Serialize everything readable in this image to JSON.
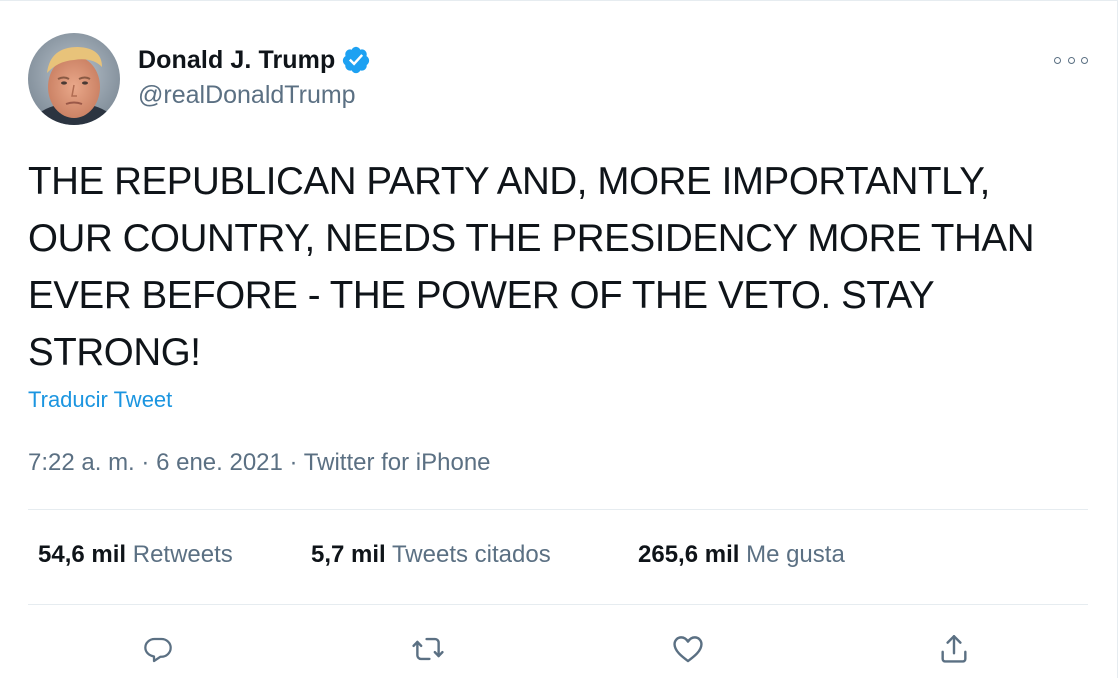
{
  "author": {
    "display_name": "Donald J. Trump",
    "handle": "@realDonaldTrump",
    "verified": true
  },
  "tweet": {
    "text_lines": [
      "THE REPUBLICAN PARTY AND, MORE IMPORTANTLY,",
      "OUR COUNTRY, NEEDS THE PRESIDENCY MORE THAN",
      "EVER BEFORE - THE POWER OF THE VETO. STAY",
      "STRONG!"
    ],
    "translate_label": "Traducir Tweet"
  },
  "meta": {
    "time": "7:22 a. m.",
    "separator": "·",
    "date": "6 ene. 2021",
    "source": "Twitter for iPhone"
  },
  "stats": {
    "retweets_count": "54,6 mil",
    "retweets_label": "Retweets",
    "quotes_count": "5,7 mil",
    "quotes_label": "Tweets citados",
    "likes_count": "265,6 mil",
    "likes_label": "Me gusta"
  },
  "icons": {
    "more": "more-horizontal-icon",
    "reply": "reply-icon",
    "retweet": "retweet-icon",
    "like": "heart-icon",
    "share": "share-icon",
    "verified": "verified-badge-icon"
  },
  "colors": {
    "text": "#0f1419",
    "secondary": "#5b7083",
    "link": "#1b95e0",
    "verified": "#1da1f2",
    "divider": "#e6ecf0"
  }
}
